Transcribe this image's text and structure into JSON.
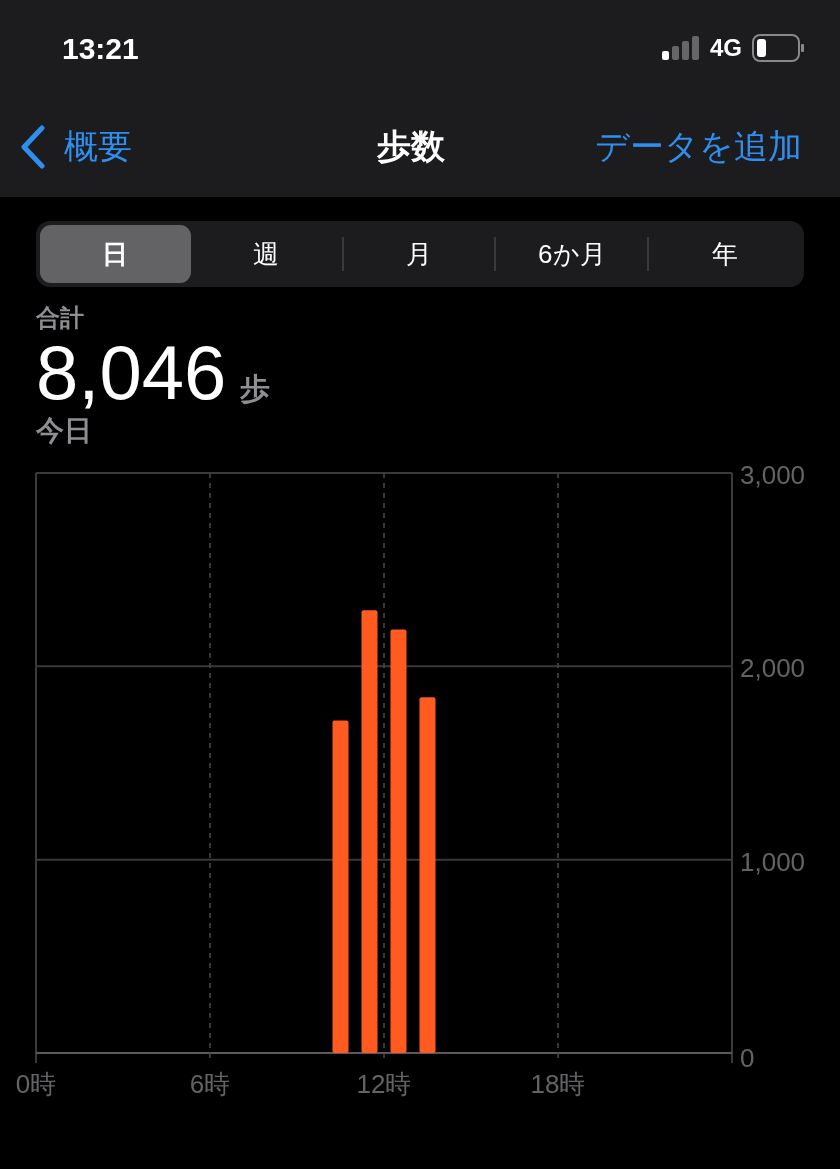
{
  "status_bar": {
    "time": "13:21",
    "network": "4G"
  },
  "nav": {
    "back": "概要",
    "title": "歩数",
    "action": "データを追加"
  },
  "tabs": [
    {
      "label": "日",
      "selected": true
    },
    {
      "label": "週",
      "selected": false
    },
    {
      "label": "月",
      "selected": false
    },
    {
      "label": "6か月",
      "selected": false
    },
    {
      "label": "年",
      "selected": false
    }
  ],
  "summary": {
    "label": "合計",
    "value": "8,046",
    "unit": "歩",
    "period": "今日"
  },
  "chart_data": {
    "type": "bar",
    "x": [
      10.5,
      11.5,
      12.5,
      13.5
    ],
    "xlim": [
      0,
      24
    ],
    "grid": true,
    "series": [
      {
        "color": "#ff5a1f",
        "values": [
          1720,
          2290,
          2190,
          1840
        ]
      }
    ],
    "ylim": [
      0,
      3000
    ],
    "yticks": [
      {
        "value": 0,
        "label": "0"
      },
      {
        "value": 1000,
        "label": "1,000"
      },
      {
        "value": 2000,
        "label": "2,000"
      },
      {
        "value": 3000,
        "label": "3,000"
      }
    ],
    "xticks": [
      {
        "value": 0,
        "label": "0時"
      },
      {
        "value": 6,
        "label": "6時"
      },
      {
        "value": 12,
        "label": "12時"
      },
      {
        "value": 18,
        "label": "18時"
      }
    ]
  }
}
